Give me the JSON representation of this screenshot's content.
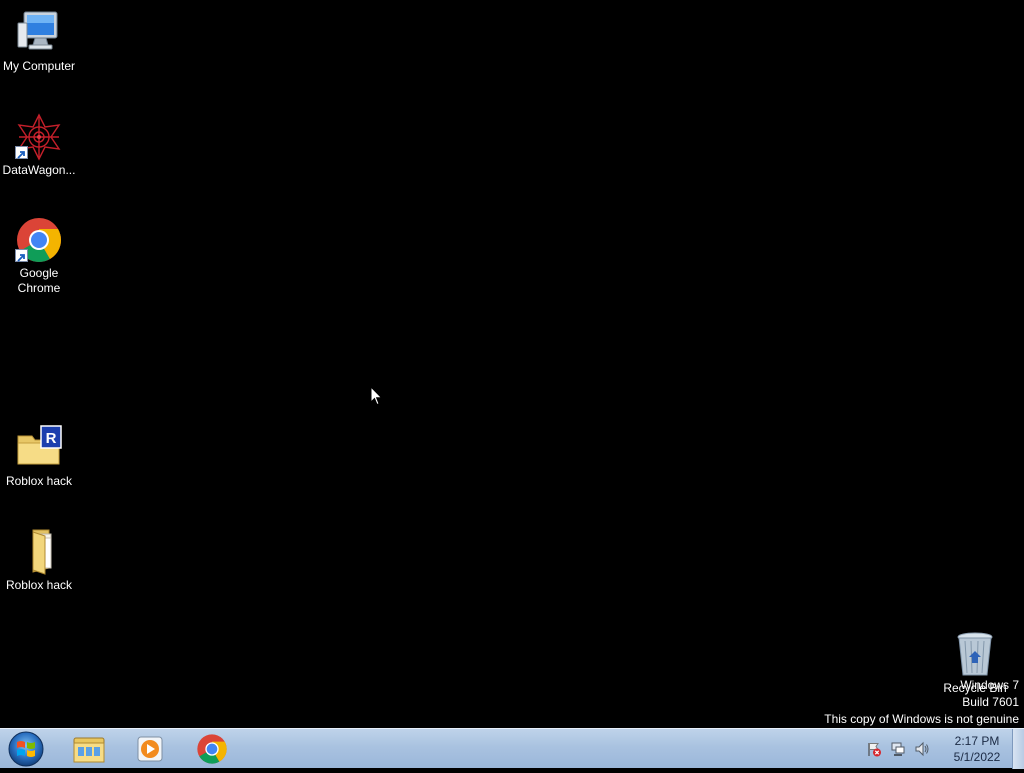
{
  "desktop": {
    "icons": [
      {
        "label": "My Computer",
        "icon": "computer-icon"
      },
      {
        "label": "DataWagon...",
        "icon": "datawagon-icon"
      },
      {
        "label": "Google Chrome",
        "icon": "chrome-icon"
      },
      {
        "label": "Roblox hack",
        "icon": "roblox-folder-icon"
      },
      {
        "label": "Roblox hack",
        "icon": "folder-icon"
      },
      {
        "label": "Recycle Bin",
        "icon": "recycle-bin-icon"
      }
    ],
    "watermark": {
      "line1": "Windows 7",
      "line2": "Build 7601",
      "line3": "This copy of Windows is not genuine"
    }
  },
  "taskbar": {
    "start_icon": "windows-logo-icon",
    "pinned": [
      {
        "name": "Windows Explorer",
        "icon": "explorer-icon"
      },
      {
        "name": "Windows Media Player",
        "icon": "media-player-icon"
      },
      {
        "name": "Google Chrome",
        "icon": "chrome-icon"
      }
    ],
    "tray": {
      "icons": [
        "action-center-flag-icon",
        "network-icon",
        "volume-icon"
      ],
      "time": "2:17 PM",
      "date": "5/1/2022"
    }
  },
  "colors": {
    "desktop_bg": "#000000",
    "taskbar_top": "#bfd3ea",
    "taskbar_bottom": "#9bb7da",
    "label_text": "#ffffff"
  }
}
